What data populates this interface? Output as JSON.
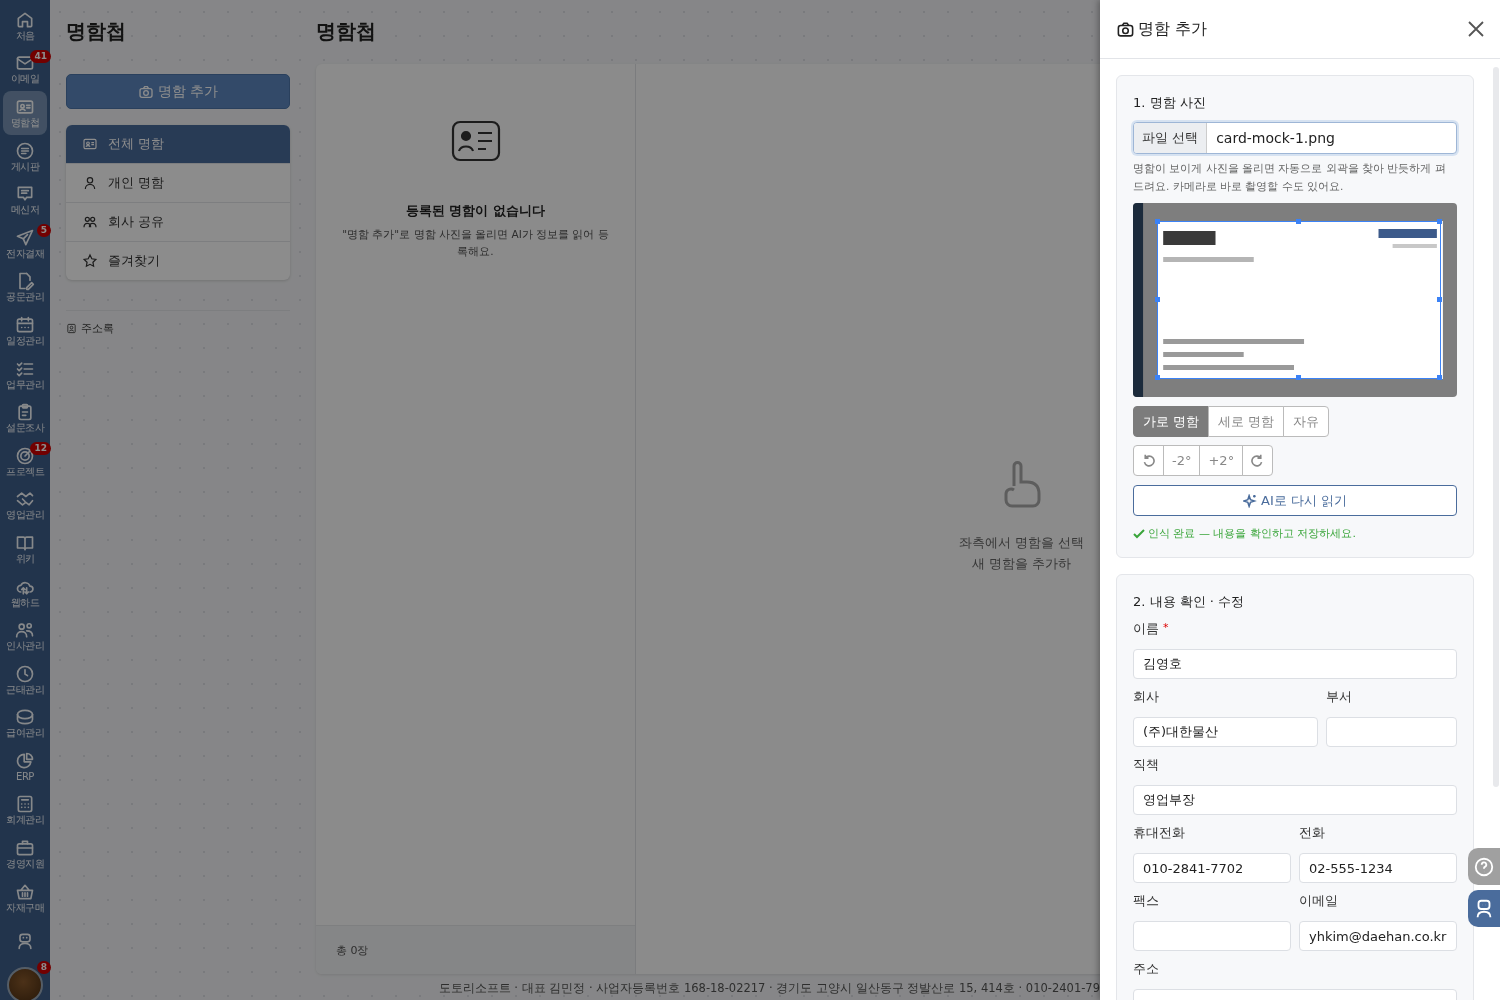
{
  "nav": [
    {
      "label": "처음",
      "selected": false
    },
    {
      "label": "이메일",
      "badge": "41",
      "selected": false
    },
    {
      "label": "명함첩",
      "selected": true
    },
    {
      "label": "게시판",
      "selected": false
    },
    {
      "label": "메신저",
      "selected": false
    },
    {
      "label": "전자결재",
      "badge": "5",
      "selected": false
    },
    {
      "label": "공문관리",
      "selected": false
    },
    {
      "label": "일정관리",
      "selected": false
    },
    {
      "label": "업무관리",
      "selected": false
    },
    {
      "label": "설문조사",
      "selected": false
    },
    {
      "label": "프로젝트",
      "badge": "12",
      "selected": false
    },
    {
      "label": "영업관리",
      "selected": false
    },
    {
      "label": "위키",
      "selected": false
    },
    {
      "label": "웹하드",
      "selected": false
    },
    {
      "label": "인사관리",
      "selected": false
    },
    {
      "label": "근태관리",
      "selected": false
    },
    {
      "label": "급여관리",
      "selected": false
    },
    {
      "label": "ERP",
      "selected": false
    },
    {
      "label": "회계관리",
      "selected": false
    },
    {
      "label": "경영지원",
      "selected": false
    },
    {
      "label": "자재구매",
      "selected": false
    },
    {
      "selected": false
    }
  ],
  "avatar": {
    "badge": "8"
  },
  "left_panel": {
    "title": "명함첩",
    "add_button": "명함 추가",
    "folders": [
      {
        "label": "전체 명함",
        "selected": true
      },
      {
        "label": "개인 명함",
        "selected": false
      },
      {
        "label": "회사 공유",
        "selected": false
      },
      {
        "label": "즐겨찾기",
        "selected": false
      }
    ],
    "address_book": "주소록"
  },
  "list": {
    "title": "명함첩",
    "empty_title": "등록된 명함이 없습니다",
    "empty_text": "\"명함 추가\"로 명함 사진을 올리면 AI가 정보를 읽어 등록해요.",
    "count": "총 0장"
  },
  "detail": {
    "hint_lines": [
      "좌측에서 명함을 선택",
      "새 명함을 추가하"
    ]
  },
  "footer": "도토리소프트 · 대표 김민정 · 사업자등록번호 168-18-02217 · 경기도 고양시 일산동구 정발산로 15, 414호 · 010-2401-79",
  "drawer": {
    "title": "명함 추가",
    "photo": {
      "heading": "1. 명함 사진",
      "file_button": "파일 선택",
      "file_name": "card-mock-1.png",
      "help": "명함이 보이게 사진을 올리면 자동으로 외곽을 찾아 반듯하게 펴 드려요. 카메라로 바로 촬영할 수도 있어요.",
      "orientation": [
        {
          "label": "가로 명함",
          "selected": true
        },
        {
          "label": "세로 명함",
          "selected": false
        },
        {
          "label": "자유",
          "selected": false
        }
      ],
      "rotate": [
        {
          "kind": "rotate-left"
        },
        {
          "kind": "step",
          "label": "-2°"
        },
        {
          "kind": "step",
          "label": "+2°"
        },
        {
          "kind": "rotate-right"
        }
      ],
      "ai_button": "AI로 다시 읽기",
      "status": "인식 완료 — 내용을 확인하고 저장하세요."
    },
    "form": {
      "heading": "2. 내용 확인 · 수정",
      "rows": [
        [
          {
            "label": "이름",
            "required_mark": "*",
            "value": "김영호"
          }
        ],
        [
          {
            "label": "회사",
            "value": "(주)대한물산"
          },
          {
            "label": "부서"
          }
        ],
        [
          {
            "label": "직책",
            "value": "영업부장"
          }
        ],
        [
          {
            "label": "휴대전화",
            "value": "010-2841-7702"
          },
          {
            "label": "전화",
            "value": "02-555-1234"
          }
        ],
        [
          {
            "label": "팩스"
          },
          {
            "label": "이메일",
            "value": "yhkim@daehan.co.kr"
          }
        ],
        [
          {
            "label": "주소"
          }
        ]
      ]
    }
  }
}
